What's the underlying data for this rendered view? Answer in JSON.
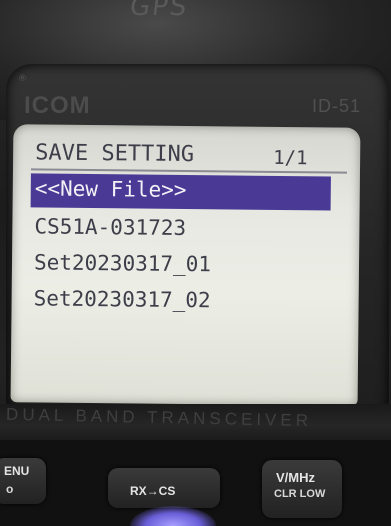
{
  "device": {
    "brand": "ICOM",
    "model_partial": "ID-51",
    "band_label": "DUAL BAND TRANSCEIVER"
  },
  "screen": {
    "title": "SAVE SETTING",
    "page_indicator": "1/1",
    "selected_index": 0,
    "items": [
      "<<New File>>",
      "CS51A-031723",
      "Set20230317_01",
      "Set20230317_02"
    ],
    "highlight_color": "#4a3a96"
  },
  "keys": {
    "menu": "ENU",
    "rx_cs": "RX→CS",
    "vmhz": "V/MHz",
    "clr_low": "CLR LOW"
  }
}
